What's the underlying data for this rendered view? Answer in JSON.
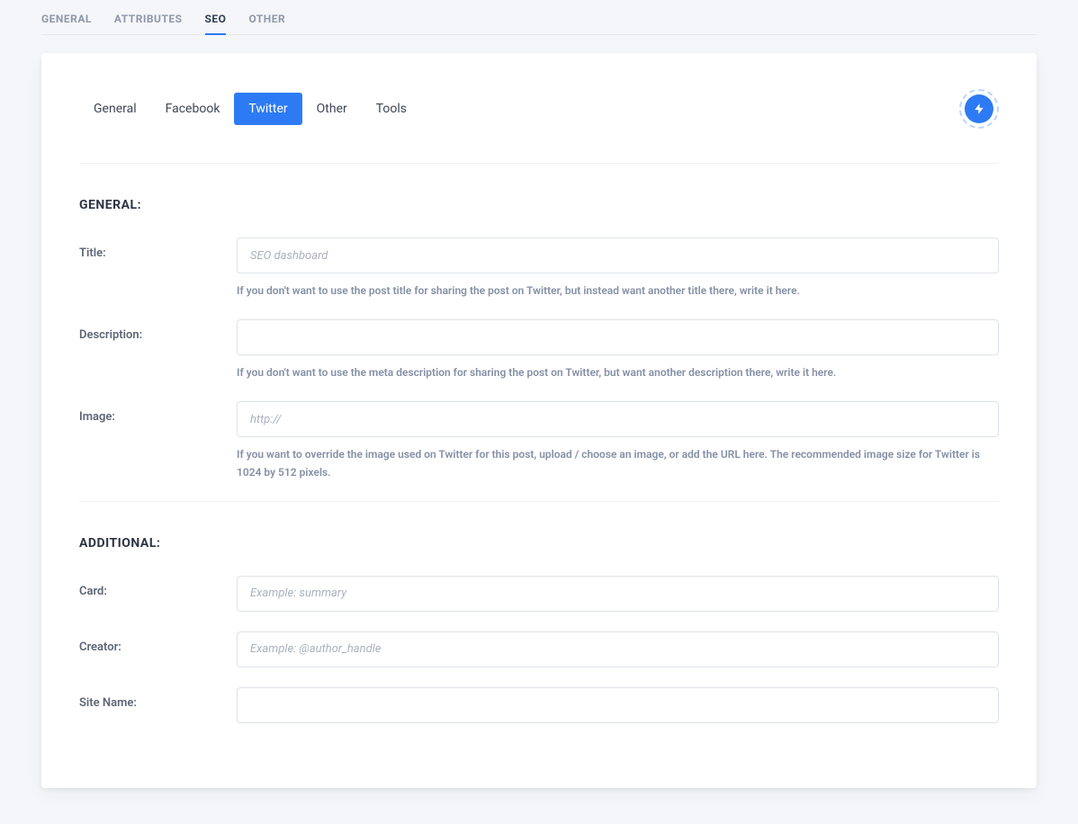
{
  "topTabs": {
    "general": "GENERAL",
    "attributes": "ATTRIBUTES",
    "seo": "SEO",
    "other": "OTHER"
  },
  "innerTabs": {
    "general": "General",
    "facebook": "Facebook",
    "twitter": "Twitter",
    "other": "Other",
    "tools": "Tools"
  },
  "sections": {
    "general": {
      "heading": "GENERAL:",
      "title": {
        "label": "Title:",
        "placeholder": "SEO dashboard",
        "help": "If you don't want to use the post title for sharing the post on Twitter, but instead want another title there, write it here."
      },
      "description": {
        "label": "Description:",
        "placeholder": "",
        "help": "If you don't want to use the meta description for sharing the post on Twitter, but want another description there, write it here."
      },
      "image": {
        "label": "Image:",
        "placeholder": "http://",
        "help": "If you want to override the image used on Twitter for this post, upload / choose an image, or add the URL here. The recommended image size for Twitter is 1024 by 512 pixels."
      }
    },
    "additional": {
      "heading": "ADDITIONAL:",
      "card": {
        "label": "Card:",
        "placeholder": "Example: summary"
      },
      "creator": {
        "label": "Creator:",
        "placeholder": "Example: @author_handle"
      },
      "siteName": {
        "label": "Site Name:",
        "placeholder": ""
      }
    }
  }
}
